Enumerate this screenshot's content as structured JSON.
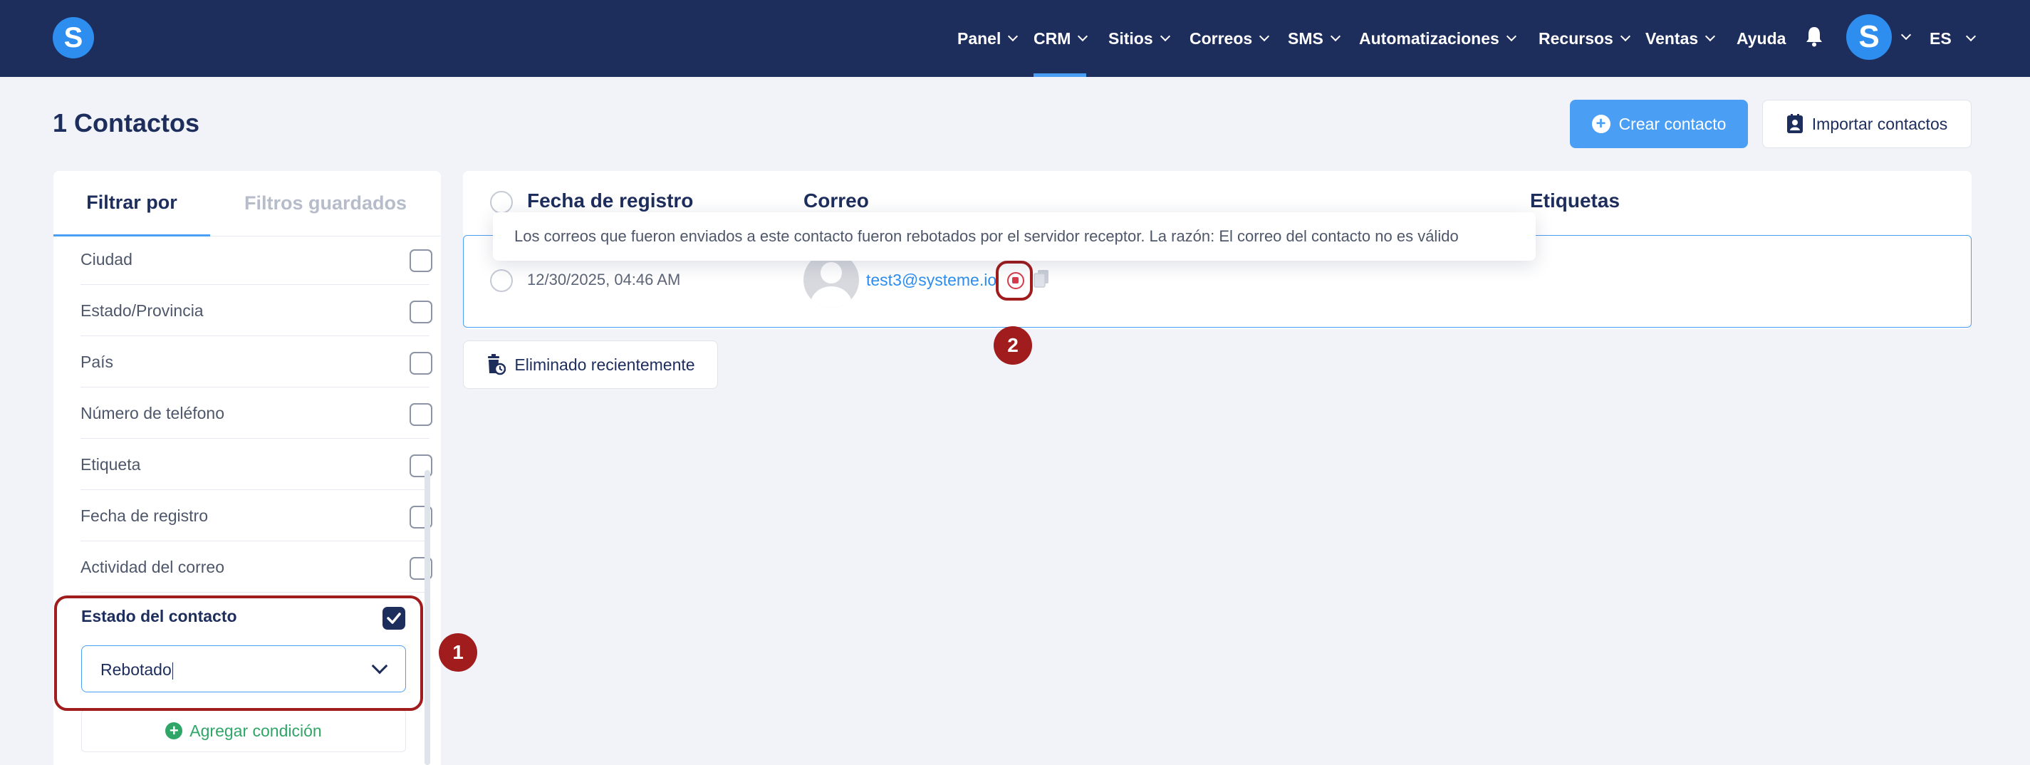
{
  "nav": {
    "logo_letter": "S",
    "items": [
      {
        "label": "Panel"
      },
      {
        "label": "CRM"
      },
      {
        "label": "Sitios"
      },
      {
        "label": "Correos"
      },
      {
        "label": "SMS"
      },
      {
        "label": "Automatizaciones"
      },
      {
        "label": "Recursos"
      },
      {
        "label": "Ventas"
      },
      {
        "label": "Ayuda"
      }
    ],
    "active_item": "CRM",
    "avatar_letter": "S",
    "language": "ES"
  },
  "header": {
    "title": "1 Contactos",
    "create_label": "Crear contacto",
    "import_label": "Importar contactos"
  },
  "filters": {
    "tabs": [
      "Filtrar por",
      "Filtros guardados"
    ],
    "items": [
      {
        "label": "Ciudad",
        "checked": false
      },
      {
        "label": "Estado/Provincia",
        "checked": false
      },
      {
        "label": "País",
        "checked": false
      },
      {
        "label": "Número de teléfono",
        "checked": false
      },
      {
        "label": "Etiqueta",
        "checked": false
      },
      {
        "label": "Fecha de registro",
        "checked": false
      },
      {
        "label": "Actividad del correo",
        "checked": false
      }
    ],
    "contact_status": {
      "label": "Estado del contacto",
      "checked": true,
      "selected_value": "Rebotado"
    },
    "add_condition_label": "Agregar condición"
  },
  "table": {
    "columns": [
      "Fecha de registro",
      "Correo",
      "Etiquetas"
    ],
    "rows": [
      {
        "date": "12/30/2025, 04:46 AM",
        "email": "test3@systeme.io"
      }
    ],
    "tooltip": "Los correos que fueron enviados a este contacto fueron rebotados por el servidor receptor. La razón: El correo del contacto no es válido",
    "recently_deleted_label": "Eliminado recientemente"
  },
  "annotations": {
    "marker_1": "1",
    "marker_2": "2"
  },
  "colors": {
    "nav_bg": "#1d2d5c",
    "accent": "#4a9ff5",
    "annotation_red": "#a11c1c",
    "bounce_red": "#d63b4c",
    "success_green": "#2fa567"
  }
}
